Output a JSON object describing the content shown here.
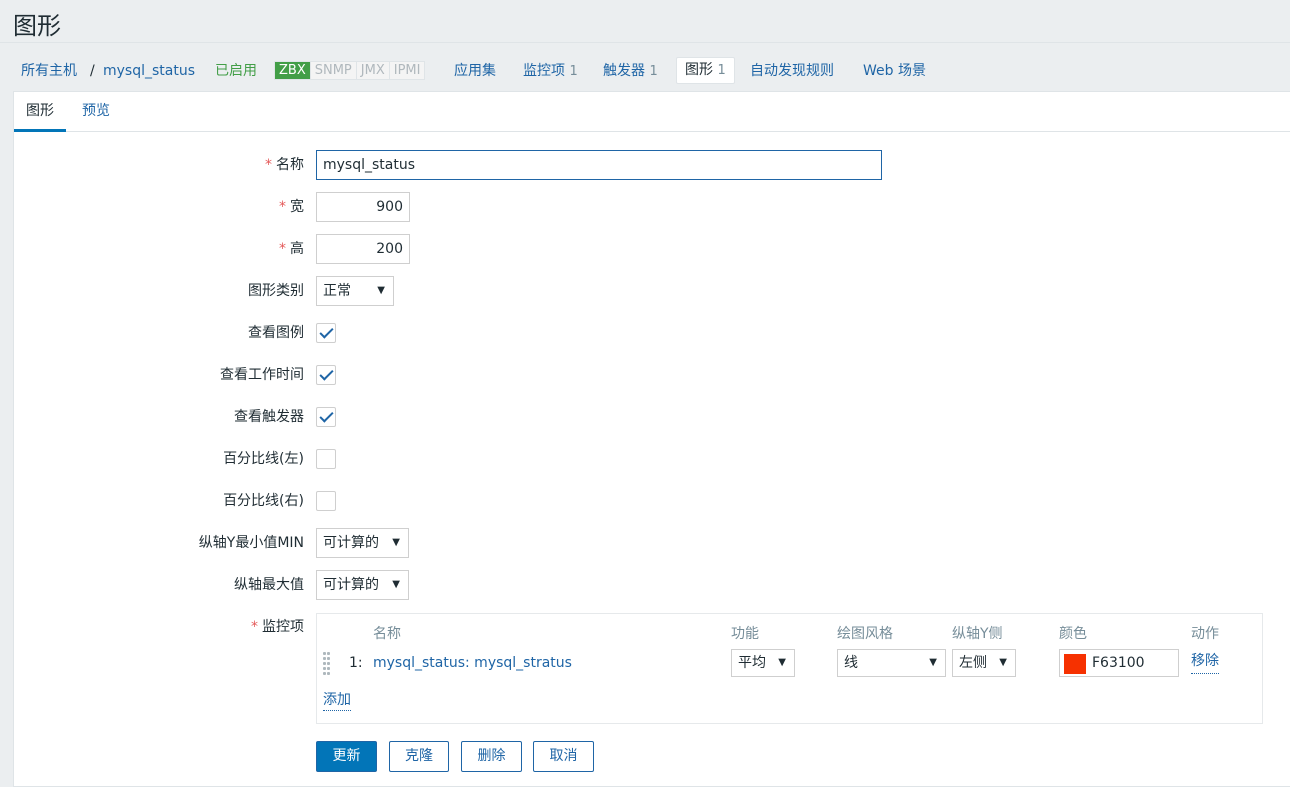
{
  "page": {
    "title": "图形"
  },
  "nav": {
    "all_hosts": "所有主机",
    "separator": "/",
    "host": "mysql_status",
    "status": "已启用",
    "protocols": [
      {
        "label": "ZBX",
        "active": true
      },
      {
        "label": "SNMP",
        "active": false
      },
      {
        "label": "JMX",
        "active": false
      },
      {
        "label": "IPMI",
        "active": false
      }
    ],
    "applications": "应用集",
    "items": {
      "label": "监控项",
      "count": "1"
    },
    "triggers": {
      "label": "触发器",
      "count": "1"
    },
    "graphs": {
      "label": "图形",
      "count": "1"
    },
    "discovery": "自动发现规则",
    "web": "Web 场景"
  },
  "tabs": [
    {
      "label": "图形",
      "active": true
    },
    {
      "label": "预览",
      "active": false
    }
  ],
  "form": {
    "name": {
      "label": "名称",
      "required": true,
      "value": "mysql_status"
    },
    "width": {
      "label": "宽",
      "required": true,
      "value": "900"
    },
    "height": {
      "label": "高",
      "required": true,
      "value": "200"
    },
    "graph_type": {
      "label": "图形类别",
      "value": "正常"
    },
    "show_legend": {
      "label": "查看图例",
      "checked": true
    },
    "show_work_period": {
      "label": "查看工作时间",
      "checked": true
    },
    "show_triggers": {
      "label": "查看触发器",
      "checked": true
    },
    "percentile_left": {
      "label": "百分比线(左)",
      "checked": false
    },
    "percentile_right": {
      "label": "百分比线(右)",
      "checked": false
    },
    "y_min": {
      "label": "纵轴Y最小值MIN",
      "value": "可计算的"
    },
    "y_max": {
      "label": "纵轴最大值",
      "value": "可计算的"
    },
    "items": {
      "label": "监控项",
      "required": true,
      "headers": {
        "name": "名称",
        "function": "功能",
        "draw_style": "绘图风格",
        "y_side": "纵轴Y侧",
        "color": "颜色",
        "action": "动作"
      },
      "rows": [
        {
          "index": "1:",
          "name": "mysql_status: mysql_stratus",
          "function": "平均",
          "draw_style": "线",
          "y_side": "左侧",
          "color": "F63100",
          "action": "移除"
        }
      ],
      "add": "添加"
    }
  },
  "buttons": {
    "update": "更新",
    "clone": "克隆",
    "delete": "删除",
    "cancel": "取消"
  },
  "colors": {
    "accent": "#0275b8",
    "link": "#1f65a6",
    "enabled": "#429e47",
    "required": "#e45959",
    "item_color": "#F63100"
  }
}
